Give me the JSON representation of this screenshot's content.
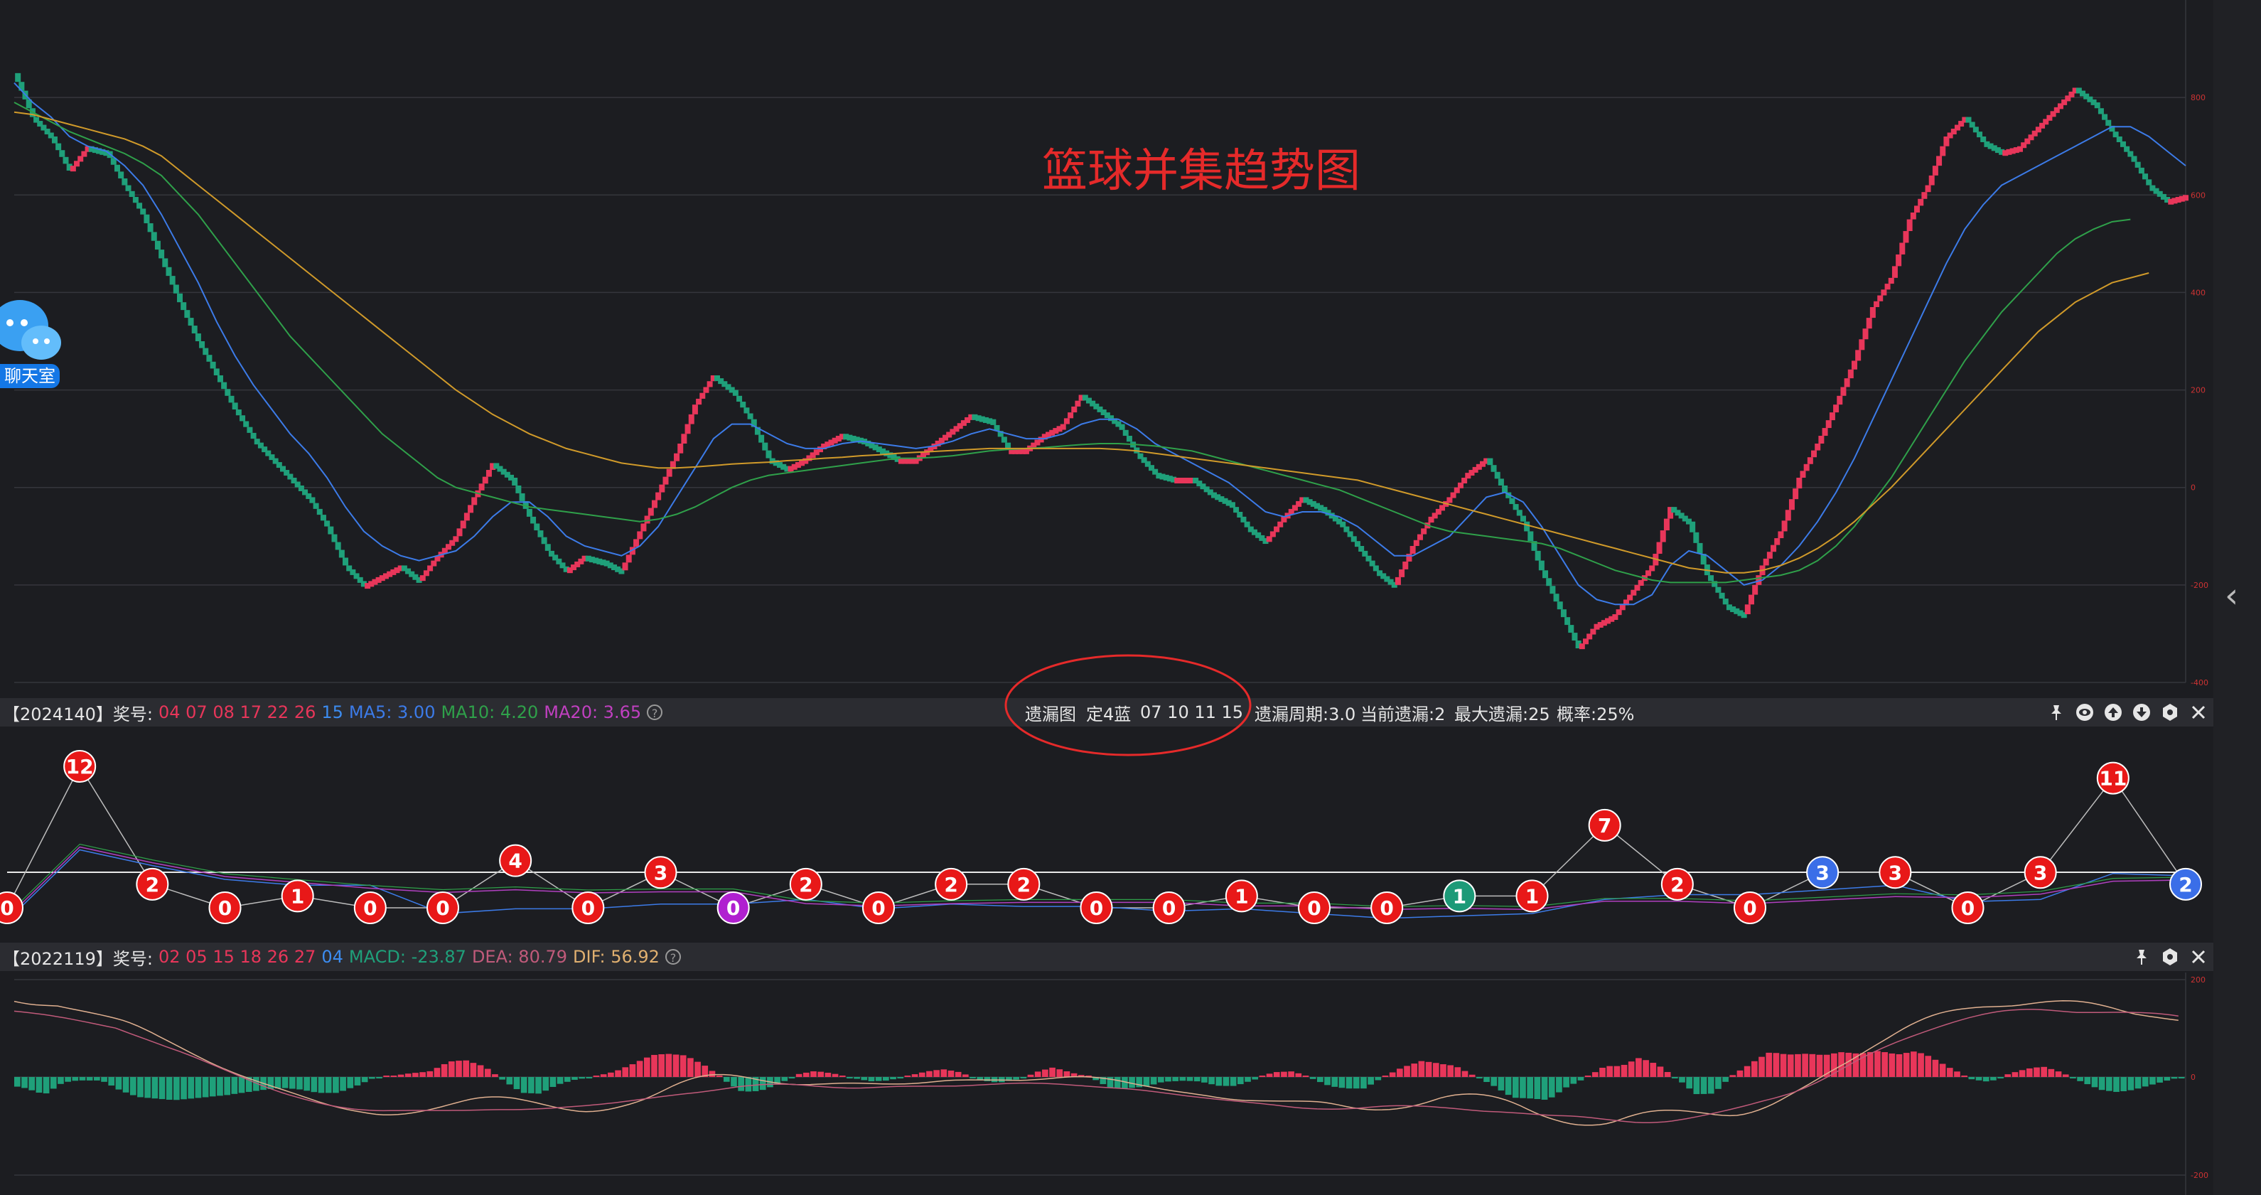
{
  "main_chart": {
    "title": "篮球并集趋势图",
    "y_ticks": [
      "800",
      "600",
      "400",
      "200",
      "0",
      "-200",
      "-400"
    ],
    "chart_data": {
      "type": "line",
      "series": [
        {
          "values": [
            850,
            760,
            720,
            650,
            700,
            690,
            620,
            560,
            470,
            380,
            300,
            230,
            160,
            100,
            60,
            20,
            -20,
            -80,
            -160,
            -200,
            -180,
            -160,
            -190,
            -140,
            -100,
            -20,
            50,
            20,
            -60,
            -130,
            -170,
            -140,
            -150,
            -170,
            -90,
            -10,
            70,
            170,
            230,
            200,
            140,
            60,
            40,
            60,
            90,
            110,
            100,
            80,
            60,
            60,
            90,
            120,
            150,
            140,
            80,
            80,
            110,
            130,
            190,
            160,
            130,
            70,
            30,
            20,
            20,
            -10,
            -30,
            -80,
            -110,
            -60,
            -20,
            -40,
            -70,
            -120,
            -170,
            -200,
            -120,
            -60,
            -20,
            30,
            60,
            -10,
            -70,
            -170,
            -250,
            -330,
            -280,
            -260,
            -210,
            -160,
            -40,
            -70,
            -180,
            -240,
            -260,
            -160,
            -90,
            20,
            90,
            170,
            260,
            370,
            430,
            550,
            620,
            720,
            760,
            710,
            690,
            700,
            740,
            780,
            820,
            790,
            730,
            680,
            620,
            590,
            600
          ]
        },
        {
          "values": [
            830,
            790,
            760,
            720,
            700,
            690,
            660,
            620,
            560,
            490,
            420,
            340,
            270,
            210,
            160,
            110,
            70,
            20,
            -40,
            -90,
            -120,
            -140,
            -150,
            -140,
            -130,
            -100,
            -60,
            -30,
            -30,
            -60,
            -100,
            -120,
            -130,
            -140,
            -120,
            -80,
            -20,
            40,
            100,
            130,
            130,
            110,
            90,
            80,
            80,
            90,
            95,
            90,
            85,
            80,
            85,
            95,
            110,
            120,
            110,
            100,
            100,
            110,
            130,
            140,
            140,
            120,
            90,
            70,
            50,
            30,
            10,
            -20,
            -50,
            -60,
            -50,
            -50,
            -60,
            -80,
            -110,
            -140,
            -140,
            -120,
            -100,
            -60,
            -20,
            -10,
            -30,
            -80,
            -140,
            -200,
            -230,
            -240,
            -240,
            -220,
            -160,
            -130,
            -140,
            -170,
            -200,
            -190,
            -160,
            -120,
            -70,
            -10,
            60,
            140,
            220,
            300,
            380,
            460,
            530,
            580,
            620,
            640,
            660,
            680,
            700,
            720,
            740,
            740,
            720,
            690,
            660
          ]
        },
        {
          "values": [
            790,
            770,
            750,
            730,
            715,
            700,
            685,
            665,
            640,
            600,
            560,
            510,
            460,
            410,
            360,
            310,
            270,
            230,
            190,
            150,
            110,
            80,
            50,
            20,
            0,
            -10,
            -20,
            -30,
            -40,
            -45,
            -50,
            -55,
            -60,
            -65,
            -70,
            -65,
            -55,
            -40,
            -20,
            0,
            15,
            25,
            30,
            35,
            40,
            45,
            50,
            55,
            60,
            60,
            62,
            65,
            70,
            75,
            78,
            80,
            82,
            85,
            88,
            90,
            90,
            88,
            85,
            80,
            75,
            65,
            55,
            45,
            35,
            25,
            15,
            5,
            -5,
            -20,
            -35,
            -50,
            -65,
            -80,
            -90,
            -95,
            -100,
            -105,
            -110,
            -115,
            -125,
            -140,
            -155,
            -170,
            -180,
            -190,
            -195,
            -195,
            -195,
            -195,
            -190,
            -185,
            -180,
            -170,
            -150,
            -120,
            -80,
            -30,
            20,
            80,
            140,
            200,
            260,
            310,
            360,
            400,
            440,
            480,
            510,
            530,
            545,
            550
          ]
        },
        {
          "values": [
            770,
            765,
            755,
            745,
            735,
            725,
            715,
            700,
            680,
            650,
            620,
            590,
            560,
            530,
            500,
            470,
            440,
            410,
            380,
            350,
            320,
            290,
            260,
            230,
            200,
            175,
            150,
            130,
            110,
            95,
            80,
            70,
            60,
            50,
            45,
            40,
            40,
            42,
            45,
            48,
            50,
            52,
            55,
            57,
            60,
            62,
            65,
            67,
            70,
            72,
            74,
            76,
            78,
            80,
            80,
            80,
            80,
            80,
            80,
            80,
            78,
            75,
            70,
            65,
            60,
            55,
            50,
            45,
            40,
            35,
            30,
            25,
            20,
            15,
            5,
            -5,
            -15,
            -25,
            -35,
            -45,
            -55,
            -65,
            -75,
            -85,
            -95,
            -105,
            -115,
            -125,
            -135,
            -145,
            -155,
            -165,
            -170,
            -175,
            -175,
            -170,
            -160,
            -145,
            -125,
            -100,
            -70,
            -35,
            0,
            40,
            80,
            120,
            160,
            200,
            240,
            280,
            320,
            350,
            380,
            400,
            420,
            430,
            440
          ]
        }
      ]
    }
  },
  "omission_bar": {
    "issue": "【2024140】",
    "award_label": "奖号:",
    "red_numbers": "04 07 08 17 22 26",
    "blue_number": "15",
    "ma5": "MA5: 3.00",
    "ma10": "MA10: 4.20",
    "ma20": "MA20: 3.65",
    "help": "?",
    "map_label": "遗漏图",
    "fixed_label": "定4蓝",
    "fixed_numbers": "07 10 11 15",
    "period": "遗漏周期:3.0",
    "current": "当前遗漏:2",
    "max": "最大遗漏:25",
    "rate": "概率:25%"
  },
  "omission_chart": {
    "chart_data": {
      "type": "line",
      "values": [
        0,
        12,
        2,
        0,
        1,
        0,
        0,
        4,
        0,
        3,
        0,
        2,
        0,
        2,
        2,
        0,
        0,
        1,
        0,
        0,
        1,
        1,
        7,
        2,
        0,
        3,
        3,
        0,
        3,
        11,
        2
      ],
      "marker_kinds": [
        "red",
        "red",
        "red",
        "red",
        "red",
        "red",
        "red",
        "red",
        "red",
        "red",
        "purple",
        "red",
        "red",
        "red",
        "red",
        "red",
        "red",
        "red",
        "red",
        "red",
        "green",
        "red",
        "red",
        "red",
        "red",
        "blue",
        "red",
        "red",
        "red",
        "red",
        "blue"
      ]
    }
  },
  "macd_bar": {
    "issue": "【2022119】",
    "award_label": "奖号:",
    "red_numbers": "02 05 15 18 26 27",
    "blue_number": "04",
    "macd": "MACD: -23.87",
    "dea": "DEA: 80.79",
    "dif": "DIF: 56.92",
    "help": "?"
  },
  "macd_chart": {
    "y_ticks": [
      "200",
      "0",
      "-200"
    ]
  },
  "chat": {
    "label": "聊天室"
  },
  "colors": {
    "background": "#1c1d21",
    "up": "#e8365a",
    "down": "#1fa07a",
    "ma5": "#3c7be8",
    "ma10": "#2fa04a",
    "ma20": "#d09a2a",
    "title": "#e52a2a"
  }
}
